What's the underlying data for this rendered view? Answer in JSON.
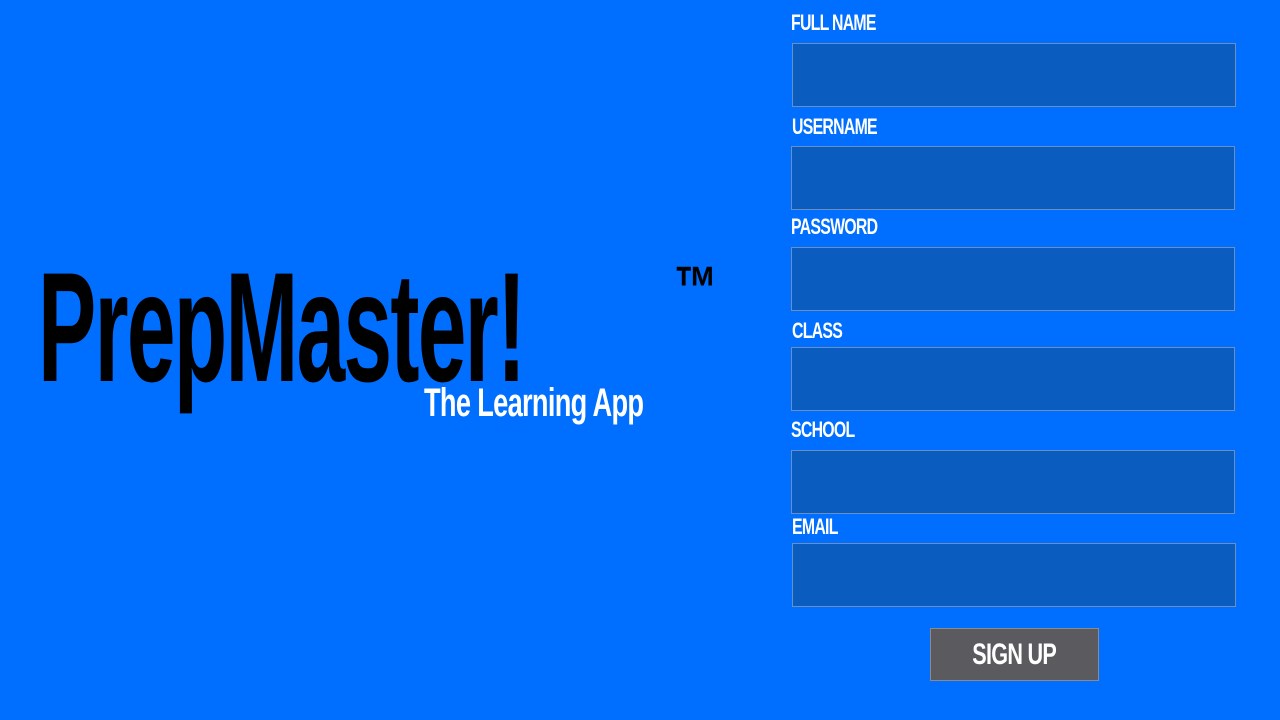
{
  "brand": {
    "title": "PrepMaster!",
    "trademark": "™",
    "subtitle": "The Learning App"
  },
  "form": {
    "fields": [
      {
        "label": "FULL NAME",
        "value": ""
      },
      {
        "label": "USERNAME",
        "value": ""
      },
      {
        "label": "PASSWORD",
        "value": ""
      },
      {
        "label": "CLASS",
        "value": ""
      },
      {
        "label": "SCHOOL",
        "value": ""
      },
      {
        "label": "EMAIL",
        "value": ""
      }
    ],
    "submit_label": "SIGN UP"
  },
  "colors": {
    "background": "#006eff",
    "input_background": "#0b5cbf",
    "button_background": "#5b5a5f",
    "title_text": "#000000",
    "label_text": "#ffffff"
  }
}
